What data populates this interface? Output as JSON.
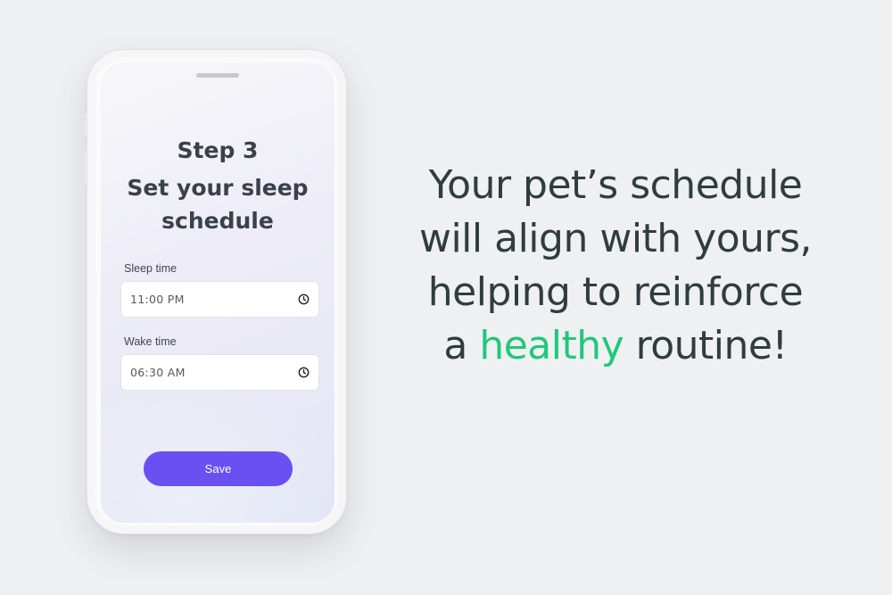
{
  "screen": {
    "step": "Step 3",
    "title_line1": "Set your sleep",
    "title_line2": "schedule",
    "sleep": {
      "label": "Sleep time",
      "value": "11:00 PM"
    },
    "wake": {
      "label": "Wake time",
      "value": "06:30 AM"
    },
    "save_label": "Save"
  },
  "tagline": {
    "line1": "Your pet’s schedule",
    "line2": "will align with yours,",
    "line3": "helping to reinforce",
    "line4_before": "a ",
    "line4_highlight": "healthy",
    "line4_after": " routine!"
  },
  "colors": {
    "background": "#eff0f2",
    "accent_button": "#6a4ff1",
    "highlight_text": "#21c77a",
    "heading_text": "#2f3d40"
  },
  "icons": {
    "time_picker": "clock-icon"
  }
}
